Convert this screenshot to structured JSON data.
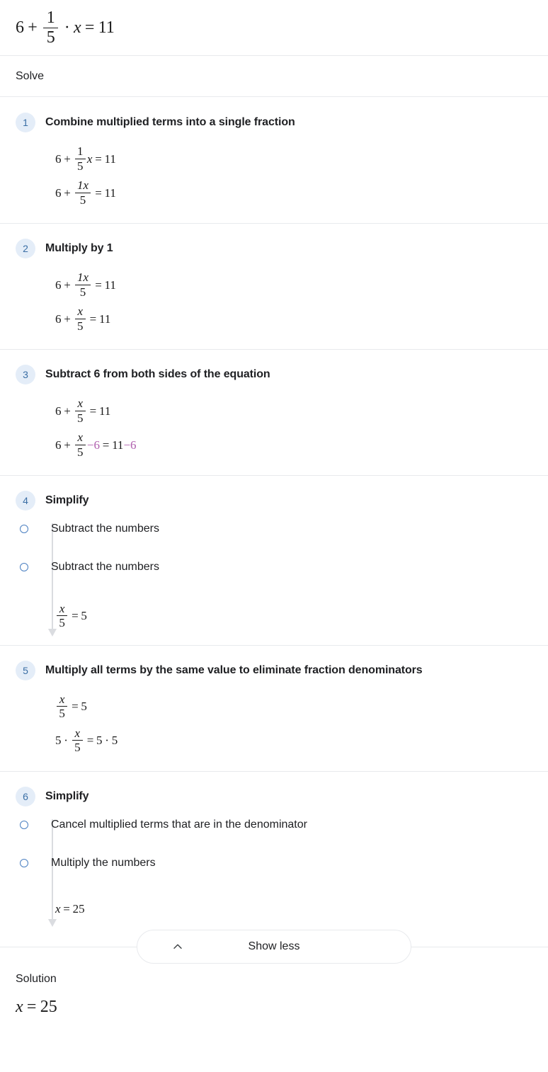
{
  "header": {
    "equation": {
      "lhs_int": "6",
      "plus": "+",
      "frac_num": "1",
      "frac_den": "5",
      "dot": "·",
      "var": "x",
      "eq": "=",
      "rhs": "11"
    }
  },
  "solve_bar": {
    "label": "Solve"
  },
  "steps": [
    {
      "number": "1",
      "title": "Combine multiplied terms into a single fraction",
      "lines": [
        {
          "a": "6",
          "op": "+",
          "num": "1",
          "den": "5",
          "var": "x",
          "eq": "=",
          "rhs": "11"
        },
        {
          "a": "6",
          "op": "+",
          "num": "1x",
          "den": "5",
          "eq": "=",
          "rhs": "11"
        }
      ]
    },
    {
      "number": "2",
      "title": "Multiply by 1",
      "lines": [
        {
          "a": "6",
          "op": "+",
          "num": "1x",
          "den": "5",
          "eq": "=",
          "rhs": "11"
        },
        {
          "a": "6",
          "op": "+",
          "num": "x",
          "den": "5",
          "eq": "=",
          "rhs": "11"
        }
      ]
    },
    {
      "number": "3",
      "title": "Subtract 6 from both sides of the equation",
      "lines": [
        {
          "a": "6",
          "op": "+",
          "num": "x",
          "den": "5",
          "eq": "=",
          "rhs": "11"
        },
        {
          "a": "6",
          "op": "+",
          "num": "x",
          "den": "5",
          "highlight_left": "−6",
          "eq": "=",
          "rhs": "11",
          "highlight_right": "−6"
        }
      ]
    },
    {
      "number": "4",
      "title": "Simplify",
      "substeps": [
        "Subtract the numbers",
        "Subtract the numbers"
      ],
      "result": {
        "num": "x",
        "den": "5",
        "eq": "=",
        "rhs": "5"
      }
    },
    {
      "number": "5",
      "title": "Multiply all terms by the same value to eliminate fraction denominators",
      "lines": [
        {
          "num": "x",
          "den": "5",
          "eq": "=",
          "rhs": "5"
        },
        {
          "mult": "5",
          "dot": "·",
          "num": "x",
          "den": "5",
          "eq": "=",
          "rhs_a": "5",
          "rhs_dot": "·",
          "rhs_b": "5"
        }
      ]
    },
    {
      "number": "6",
      "title": "Simplify",
      "substeps": [
        "Cancel multiplied terms that are in the denominator",
        "Multiply the numbers"
      ],
      "result_simple": {
        "var": "x",
        "eq": "=",
        "rhs": "25"
      }
    }
  ],
  "show_less": {
    "label": "Show less",
    "icon": "chevron-up-icon"
  },
  "solution": {
    "label": "Solution",
    "equation": {
      "var": "x",
      "eq": "=",
      "rhs": "25"
    }
  },
  "colors": {
    "badge_bg": "#e4edf8",
    "badge_text": "#3a6ea5",
    "highlight": "#b05fae",
    "dot_border": "#4a7fc1",
    "rail": "#dadce0",
    "divider": "#e8eaed",
    "text": "#202124"
  }
}
